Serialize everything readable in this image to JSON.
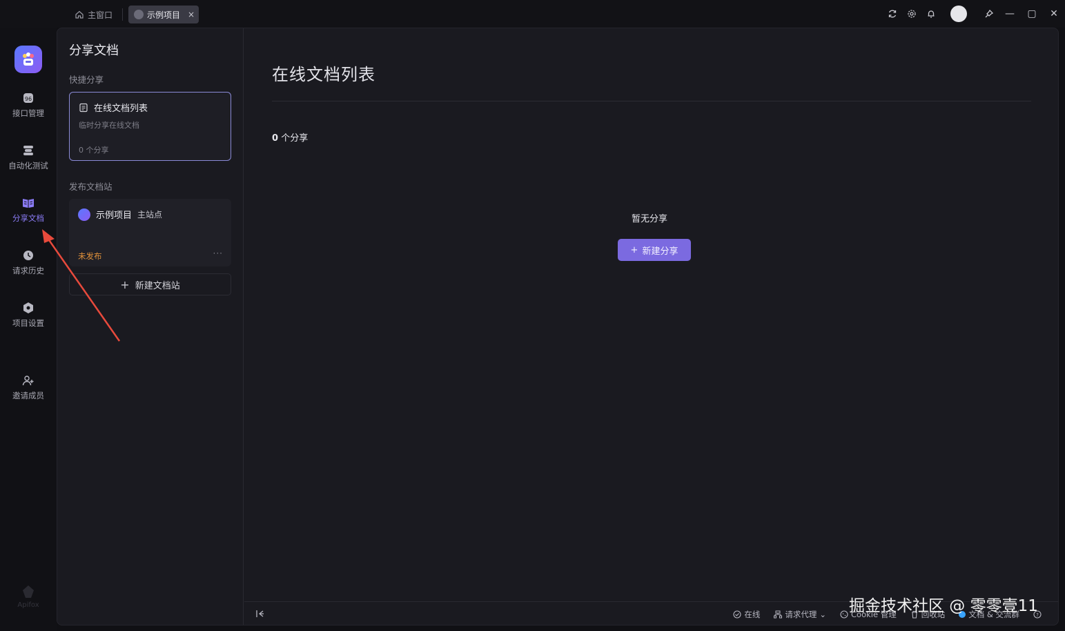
{
  "tabs": {
    "home_label": "主窗口",
    "project_label": "示例项目",
    "close_glyph": "×"
  },
  "topbar": {
    "icons": [
      "refresh-icon",
      "settings-icon",
      "bell-icon",
      "avatar",
      "pin-icon"
    ],
    "window": {
      "minimize": "—",
      "maximize": "▢",
      "close": "✕"
    }
  },
  "rail": {
    "items": [
      {
        "label": "接口管理",
        "icon": "api-icon"
      },
      {
        "label": "自动化测试",
        "icon": "automation-icon"
      },
      {
        "label": "分享文档",
        "icon": "share-doc-icon",
        "active": true
      },
      {
        "label": "请求历史",
        "icon": "history-icon"
      },
      {
        "label": "项目设置",
        "icon": "project-settings-icon"
      },
      {
        "label": "邀请成员",
        "icon": "invite-member-icon"
      }
    ],
    "bottom_brand": "Apifox"
  },
  "side": {
    "title": "分享文档",
    "quick_section": "快捷分享",
    "quick_card": {
      "title": "在线文档列表",
      "subtitle": "临时分享在线文档",
      "count": "0 个分享"
    },
    "publish_section": "发布文档站",
    "publish_card": {
      "project": "示例项目",
      "site": "主站点",
      "status": "未发布",
      "more": "···"
    },
    "new_site_label": "新建文档站"
  },
  "main": {
    "title": "在线文档列表",
    "count_num": "0",
    "count_label": "个分享",
    "empty_text": "暂无分享",
    "new_share_label": "新建分享"
  },
  "statusbar": {
    "online": "在线",
    "proxy": "请求代理",
    "cookie": "Cookie 管理",
    "recycle": "回收站",
    "docs": "文档 & 交流群"
  },
  "watermark": "掘金技术社区 @ 零零壹11",
  "colors": {
    "accent": "#7b6ae0",
    "active_rail": "#8b7cf6",
    "warning": "#e0913a",
    "arrow": "#e84a3c"
  }
}
